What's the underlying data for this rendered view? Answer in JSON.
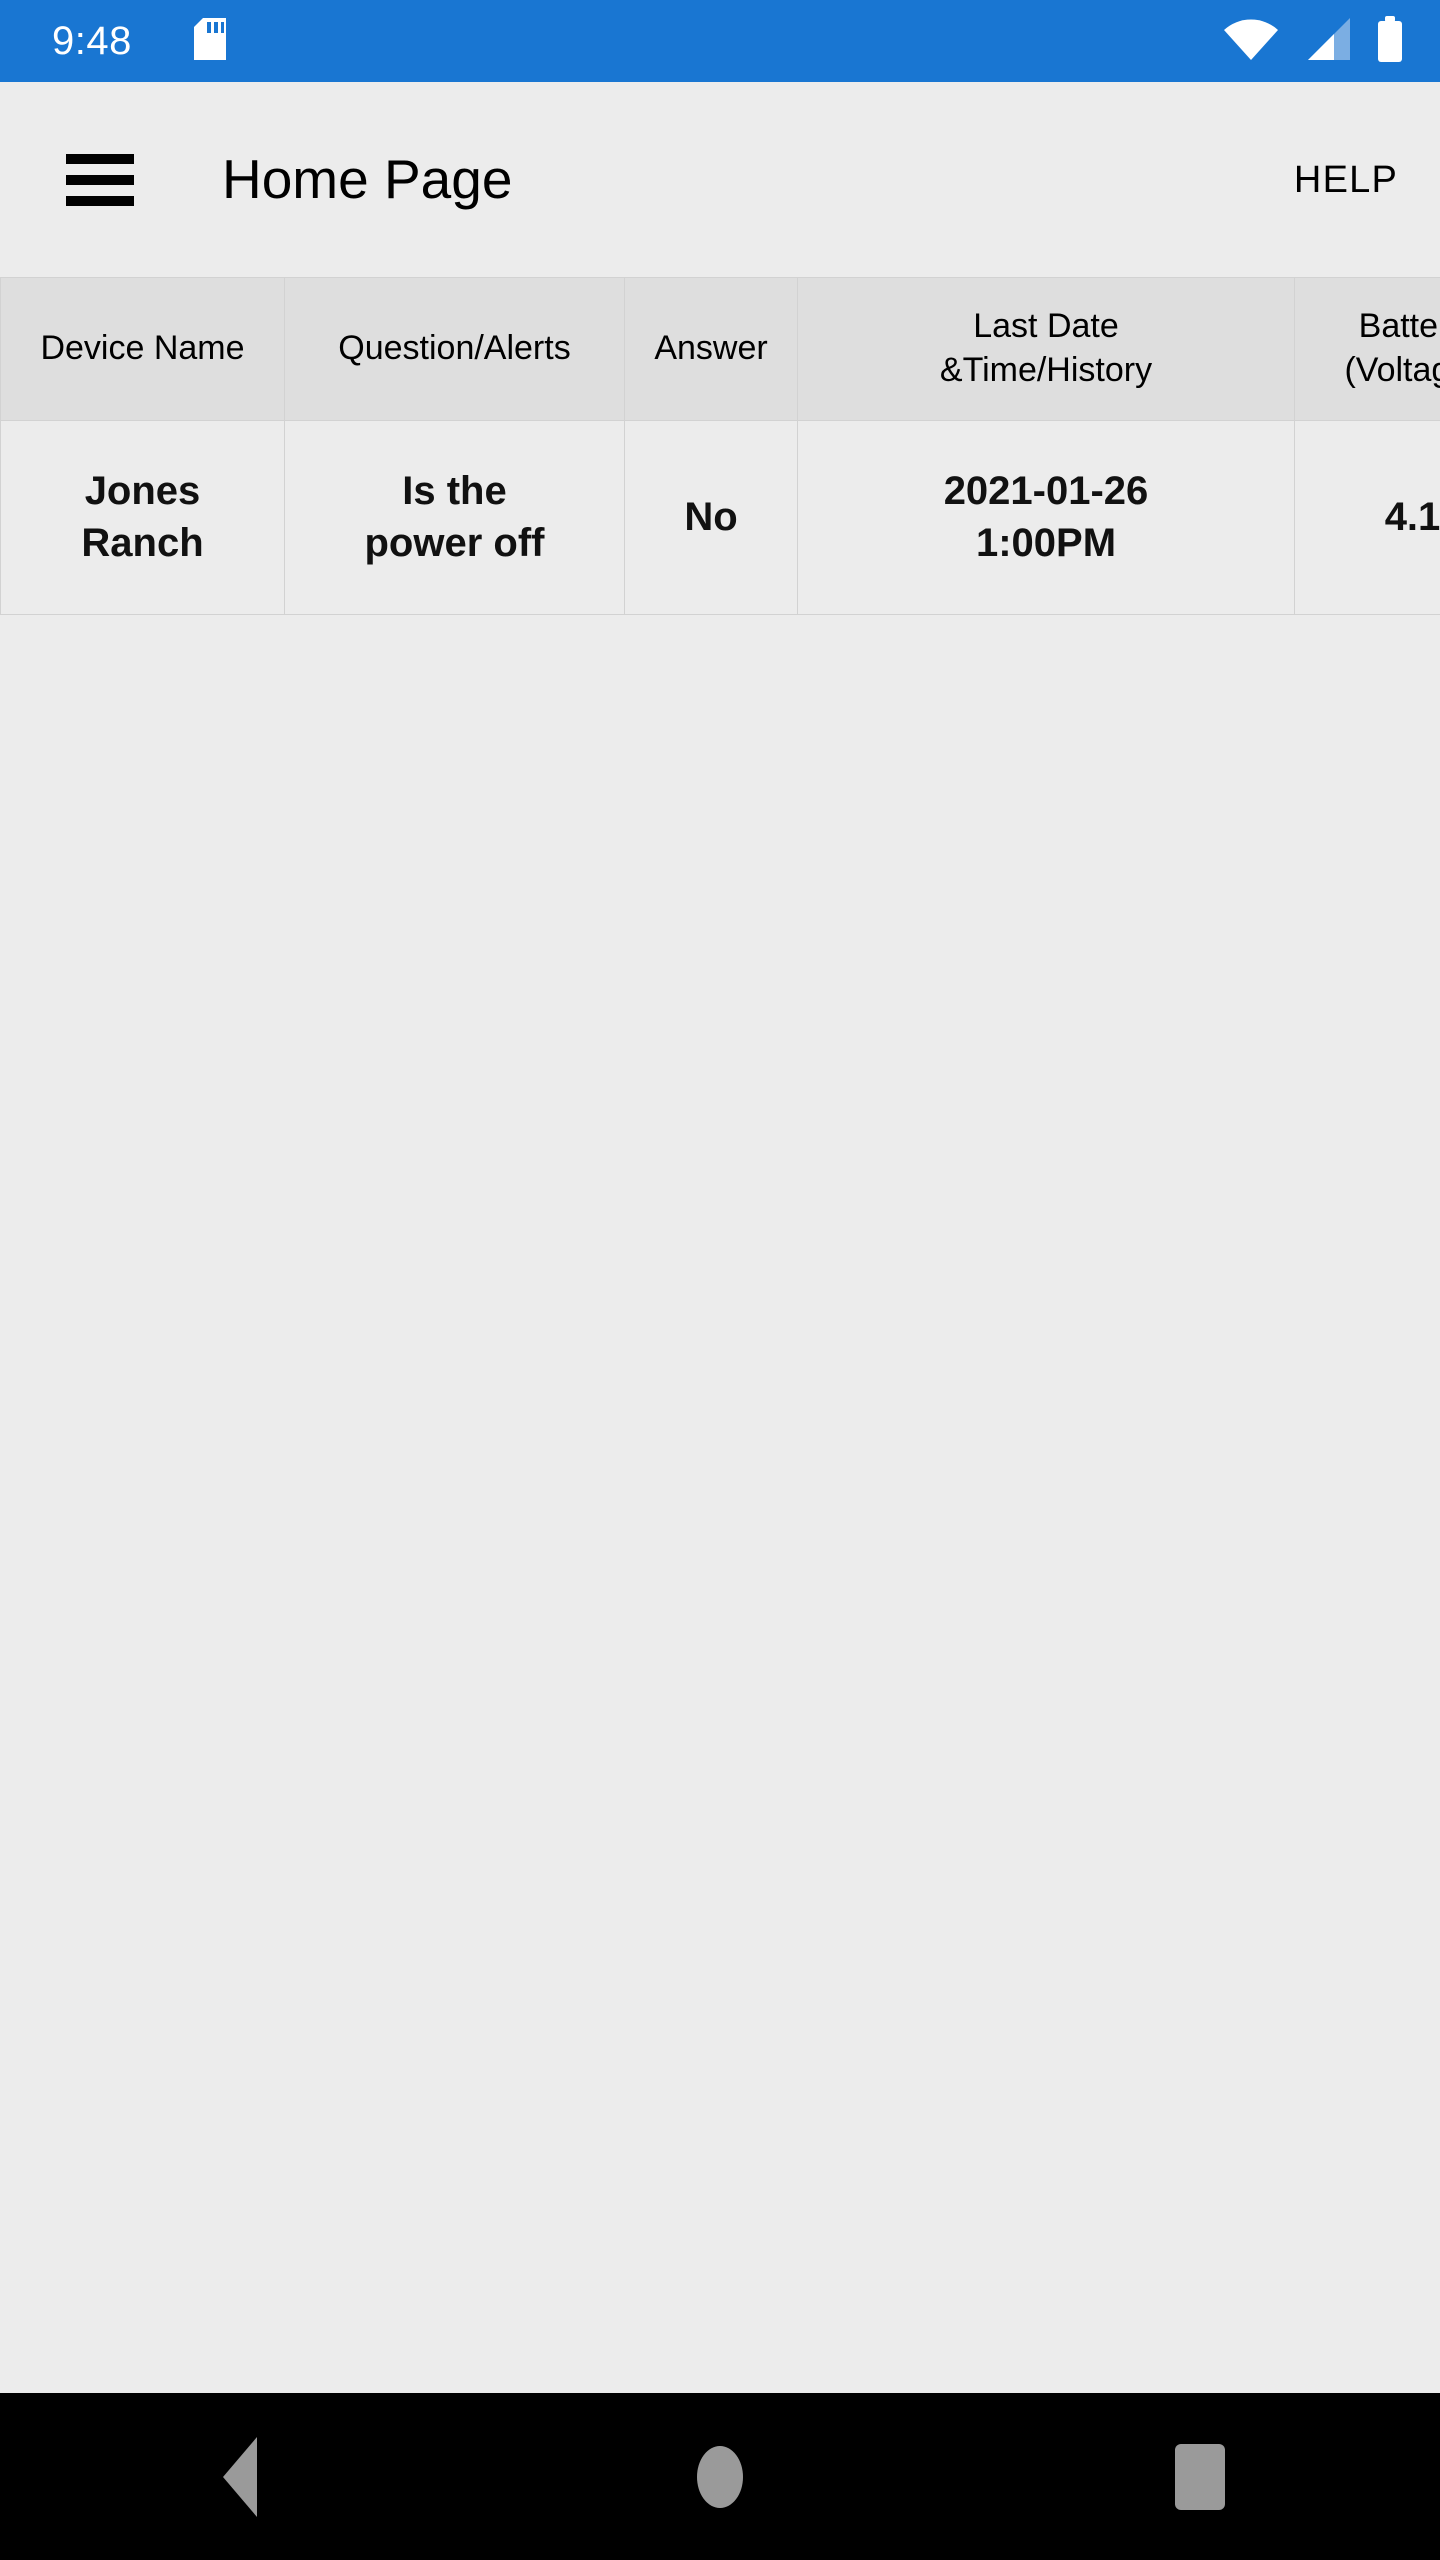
{
  "status_bar": {
    "clock": "9:48",
    "icons": {
      "sd_card": "sd-card-icon",
      "wifi": "wifi-full-icon",
      "cellular": "cellular-signal-2-bars-icon",
      "battery": "battery-full-icon"
    },
    "background_color": "#1976d2",
    "foreground_color": "#ffffff"
  },
  "app_bar": {
    "menu_icon": "hamburger-menu-icon",
    "title": "Home Page",
    "help_label": "HELP",
    "background_color": "#ececec",
    "text_color": "#000000"
  },
  "table": {
    "headers": [
      "Device Name",
      "Question/Alerts",
      "Answer",
      "Last Date\n&Time/History",
      "Battery\n(Voltage)"
    ],
    "header_lines": {
      "device_name": "Device Name",
      "question_alerts": "Question/Alerts",
      "answer": "Answer",
      "last_date_line1": "Last Date",
      "last_date_line2": "&Time/History",
      "battery_line1": "Battery",
      "battery_line2": "(Voltage)"
    },
    "rows": [
      {
        "device_name_line1": "Jones",
        "device_name_line2": "Ranch",
        "question_line1": "Is the",
        "question_line2": "power off",
        "answer": "No",
        "date_line1": "2021-01-26",
        "date_line2": "1:00PM",
        "battery": "4.1"
      }
    ],
    "header_background_color": "#dedede",
    "row_background_color": "#ececec",
    "border_color": "#d2d2d2"
  },
  "nav_bar": {
    "back": "back-triangle-icon",
    "home": "home-circle-icon",
    "recents": "recents-square-icon",
    "background_color": "#000000",
    "icon_color": "#9a9a9a"
  }
}
